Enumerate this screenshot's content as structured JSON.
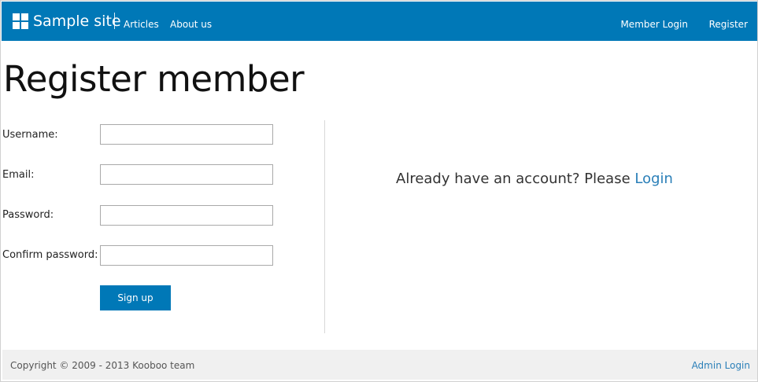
{
  "navbar": {
    "brand": "Sample site",
    "links": [
      {
        "label": "Articles"
      },
      {
        "label": "About us"
      }
    ],
    "right_links": [
      {
        "label": "Member Login"
      },
      {
        "label": "Register"
      }
    ]
  },
  "page": {
    "title": "Register member"
  },
  "form": {
    "fields": [
      {
        "label": "Username:",
        "value": ""
      },
      {
        "label": "Email:",
        "value": ""
      },
      {
        "label": "Password:",
        "value": ""
      },
      {
        "label": "Confirm password:",
        "value": ""
      }
    ],
    "submit_label": "Sign up"
  },
  "sidebar": {
    "prompt_text": "Already have an account? Please",
    "login_link": "Login"
  },
  "footer": {
    "copyright": "Copyright © 2009 - 2013 Kooboo team",
    "admin_login": "Admin Login"
  },
  "colors": {
    "brand_blue": "#0078b7",
    "link_blue": "#2a7fb8",
    "footer_bg": "#f0f0f0"
  }
}
